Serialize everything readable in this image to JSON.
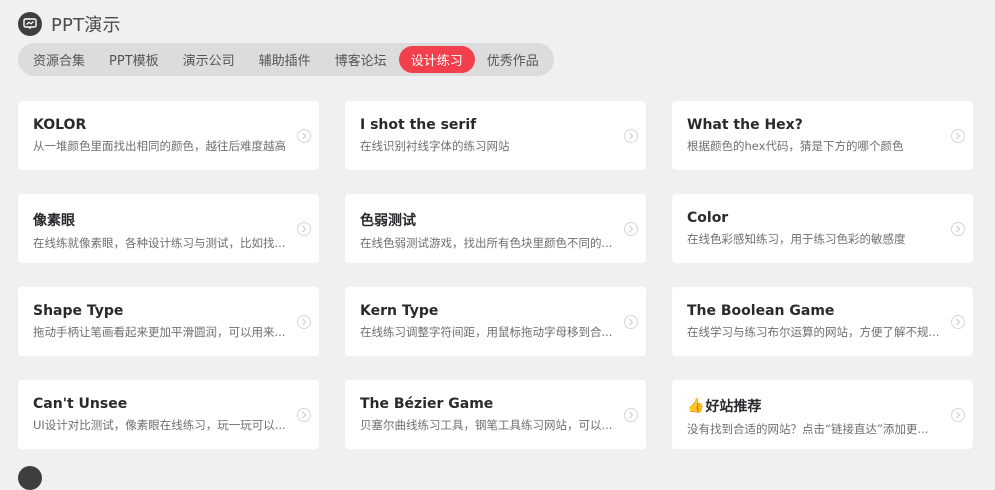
{
  "section": {
    "title": "PPT演示",
    "icon": "presentation-icon"
  },
  "tabs": [
    {
      "label": "资源合集",
      "active": false
    },
    {
      "label": "PPT模板",
      "active": false
    },
    {
      "label": "演示公司",
      "active": false
    },
    {
      "label": "辅助插件",
      "active": false
    },
    {
      "label": "博客论坛",
      "active": false
    },
    {
      "label": "设计练习",
      "active": true
    },
    {
      "label": "优秀作品",
      "active": false
    }
  ],
  "cards": [
    {
      "title": "KOLOR",
      "desc": "从一堆颜色里面找出相同的颜色，越往后难度越高"
    },
    {
      "title": "I shot the serif",
      "desc": "在线识别衬线字体的练习网站"
    },
    {
      "title": "What the Hex?",
      "desc": "根据颜色的hex代码，猜是下方的哪个颜色"
    },
    {
      "title": "像素眼",
      "desc": "在线练就像素眼，各种设计练习与测试，比如找..."
    },
    {
      "title": "色弱测试",
      "desc": "在线色弱测试游戏，找出所有色块里颜色不同的..."
    },
    {
      "title": "Color",
      "desc": "在线色彩感知练习，用于练习色彩的敏感度"
    },
    {
      "title": "Shape Type",
      "desc": "拖动手柄让笔画看起来更加平滑圆润，可以用来..."
    },
    {
      "title": "Kern Type",
      "desc": "在线练习调整字符间距，用鼠标拖动字母移到合..."
    },
    {
      "title": "The Boolean Game",
      "desc": "在线学习与练习布尔运算的网站，方便了解不规..."
    },
    {
      "title": "Can't Unsee",
      "desc": "UI设计对比测试，像素眼在线练习，玩一玩可以..."
    },
    {
      "title": "The Bézier Game",
      "desc": "贝塞尔曲线练习工具，钢笔工具练习网站，可以..."
    },
    {
      "title": "好站推荐",
      "desc": "没有找到合适的网站？点击“链接直达”添加更...",
      "emoji": "👍"
    }
  ],
  "colors": {
    "accent": "#f1404b",
    "background": "#f0f0f2",
    "tabs_bg": "#dcdcdc"
  }
}
